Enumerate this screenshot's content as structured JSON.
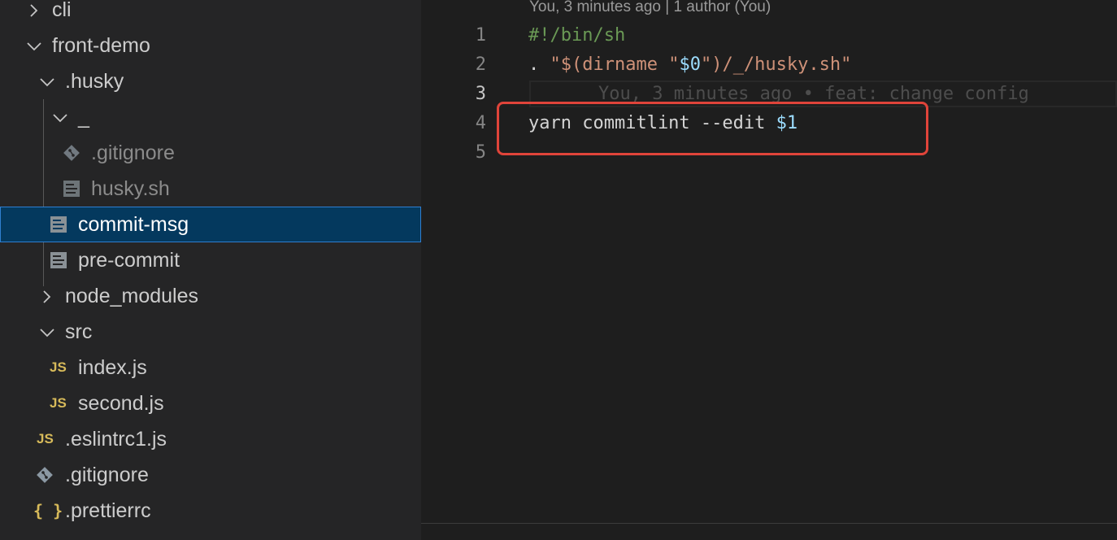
{
  "explorer": {
    "items": [
      {
        "label": "cli",
        "type": "folder",
        "expanded": false
      },
      {
        "label": "front-demo",
        "type": "folder",
        "expanded": true
      },
      {
        "label": ".husky",
        "type": "folder",
        "expanded": true
      },
      {
        "label": "_",
        "type": "folder",
        "expanded": true
      },
      {
        "label": ".gitignore",
        "type": "file",
        "icon": "git-icon"
      },
      {
        "label": "husky.sh",
        "type": "file",
        "icon": "file-lines-icon"
      },
      {
        "label": "commit-msg",
        "type": "file",
        "icon": "file-lines-icon",
        "selected": true
      },
      {
        "label": "pre-commit",
        "type": "file",
        "icon": "file-lines-icon"
      },
      {
        "label": "node_modules",
        "type": "folder",
        "expanded": false
      },
      {
        "label": "src",
        "type": "folder",
        "expanded": true
      },
      {
        "label": "index.js",
        "type": "file",
        "icon": "js-icon"
      },
      {
        "label": "second.js",
        "type": "file",
        "icon": "js-icon"
      },
      {
        "label": ".eslintrc1.js",
        "type": "file",
        "icon": "js-icon"
      },
      {
        "label": ".gitignore",
        "type": "file",
        "icon": "git-icon"
      },
      {
        "label": ".prettierrc",
        "type": "file",
        "icon": "json-braces-icon"
      }
    ],
    "js_badge": "JS",
    "braces_badge": "{ }",
    "selection_color": "#04395e"
  },
  "editor": {
    "blame_header": "You, 3 minutes ago | 1 author (You)",
    "line_numbers": [
      "1",
      "2",
      "3",
      "4",
      "5"
    ],
    "current_line": "3",
    "lines": {
      "l1": "#!/bin/sh",
      "l2": {
        "dot": ". ",
        "s1": "\"$(dirname \"",
        "v1": "$0",
        "s2": "\")/_/husky.sh\""
      },
      "l3": "",
      "l4": {
        "text": "yarn commitlint --edit ",
        "var": "$1"
      },
      "l5": ""
    },
    "inline_blame": "You, 3 minutes ago • feat: change config",
    "highlight_color": "#e0443a"
  }
}
